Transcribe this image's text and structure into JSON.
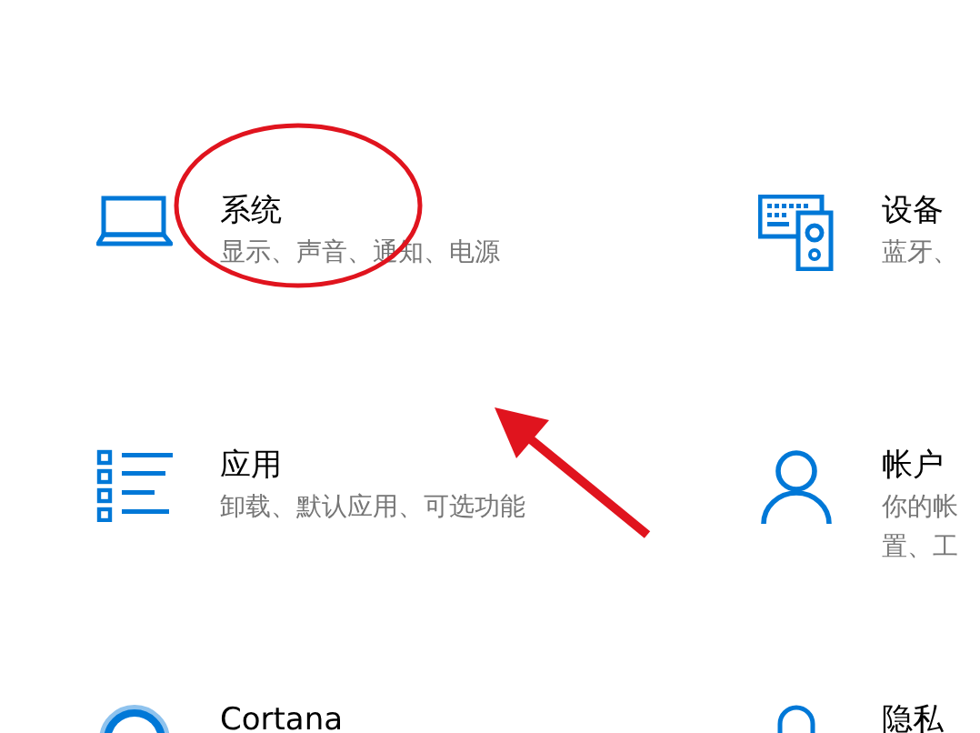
{
  "items": [
    {
      "kind": "system",
      "title": "系统",
      "description_lines": [
        "显示、声音、通知、电源"
      ]
    },
    {
      "kind": "devices",
      "title": "设备",
      "description_lines": [
        "蓝牙、"
      ]
    },
    {
      "kind": "apps",
      "title": "应用",
      "description_lines": [
        "卸载、默认应用、可选功能"
      ]
    },
    {
      "kind": "accounts",
      "title": "帐户",
      "description_lines": [
        "你的帐",
        "置、工"
      ]
    },
    {
      "kind": "cortana",
      "title": "Cortana"
    },
    {
      "kind": "privacy",
      "title": "隐私"
    }
  ]
}
